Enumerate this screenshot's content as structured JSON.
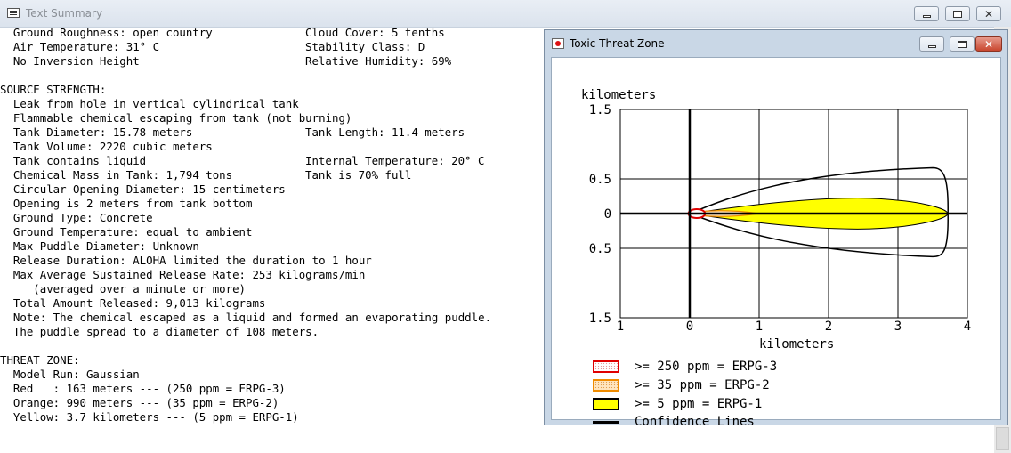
{
  "main_window": {
    "title": "Text Summary",
    "report_lines": [
      [
        "  Ground Roughness: open country",
        "Cloud Cover: 5 tenths"
      ],
      [
        "  Air Temperature: 31° C",
        "Stability Class: D"
      ],
      [
        "  No Inversion Height",
        "Relative Humidity: 69%"
      ],
      [
        "",
        ""
      ],
      [
        "SOURCE STRENGTH:",
        ""
      ],
      [
        "  Leak from hole in vertical cylindrical tank",
        ""
      ],
      [
        "  Flammable chemical escaping from tank (not burning)",
        ""
      ],
      [
        "  Tank Diameter: 15.78 meters",
        "Tank Length: 11.4 meters"
      ],
      [
        "  Tank Volume: 2220 cubic meters",
        ""
      ],
      [
        "  Tank contains liquid",
        "Internal Temperature: 20° C"
      ],
      [
        "  Chemical Mass in Tank: 1,794 tons",
        "Tank is 70% full"
      ],
      [
        "  Circular Opening Diameter: 15 centimeters",
        ""
      ],
      [
        "  Opening is 2 meters from tank bottom",
        ""
      ],
      [
        "  Ground Type: Concrete",
        ""
      ],
      [
        "  Ground Temperature: equal to ambient",
        ""
      ],
      [
        "  Max Puddle Diameter: Unknown",
        ""
      ],
      [
        "  Release Duration: ALOHA limited the duration to 1 hour",
        ""
      ],
      [
        "  Max Average Sustained Release Rate: 253 kilograms/min",
        ""
      ],
      [
        "     (averaged over a minute or more)",
        ""
      ],
      [
        "  Total Amount Released: 9,013 kilograms",
        ""
      ],
      [
        "  Note: The chemical escaped as a liquid and formed an evaporating puddle.",
        ""
      ],
      [
        "  The puddle spread to a diameter of 108 meters.",
        ""
      ],
      [
        "",
        ""
      ],
      [
        "THREAT ZONE:",
        ""
      ],
      [
        "  Model Run: Gaussian",
        ""
      ],
      [
        "  Red   : 163 meters --- (250 ppm = ERPG-3)",
        ""
      ],
      [
        "  Orange: 990 meters --- (35 ppm = ERPG-2)",
        ""
      ],
      [
        "  Yellow: 3.7 kilometers --- (5 ppm = ERPG-1)",
        ""
      ]
    ]
  },
  "threat_window": {
    "title": "Toxic Threat Zone",
    "y_axis_label": "kilometers",
    "x_axis_label": "kilometers",
    "y_tick_labels": [
      "1.5",
      "0.5",
      "0",
      "0.5",
      "1.5"
    ],
    "x_tick_labels": [
      "1",
      "0",
      "1",
      "2",
      "3",
      "4"
    ],
    "legend": [
      {
        "label": ">= 250 ppm = ERPG-3",
        "fill": "#ffffff",
        "border": "#e00000",
        "dotted": true
      },
      {
        "label": ">= 35 ppm = ERPG-2",
        "fill": "#ffe0b0",
        "border": "#f08c00",
        "dotted": true
      },
      {
        "label": ">= 5 ppm = ERPG-1",
        "fill": "#ffff00",
        "border": "#000000",
        "dotted": false
      },
      {
        "label": "Confidence Lines",
        "fill": "",
        "border": "#000000",
        "line": true
      }
    ]
  },
  "chart_data": {
    "type": "area",
    "xlabel": "kilometers",
    "ylabel": "kilometers",
    "xlim": [
      -1,
      4
    ],
    "ylim": [
      -1.5,
      1.5
    ],
    "x_ticks": [
      -1,
      0,
      1,
      2,
      3,
      4
    ],
    "y_ticks": [
      1.5,
      0.5,
      0,
      -0.5,
      -1.5
    ],
    "grid": true,
    "legend_position": "bottom",
    "series": [
      {
        "name": ">= 250 ppm = ERPG-3",
        "color": "#e00000",
        "extent_km": 0.163
      },
      {
        "name": ">= 35 ppm = ERPG-2",
        "color": "#f08c00",
        "extent_km": 0.99
      },
      {
        "name": ">= 5 ppm = ERPG-1",
        "color": "#ffff00",
        "extent_km": 3.7
      },
      {
        "name": "Confidence Lines",
        "color": "#000000",
        "extent_km": 3.7
      }
    ]
  }
}
